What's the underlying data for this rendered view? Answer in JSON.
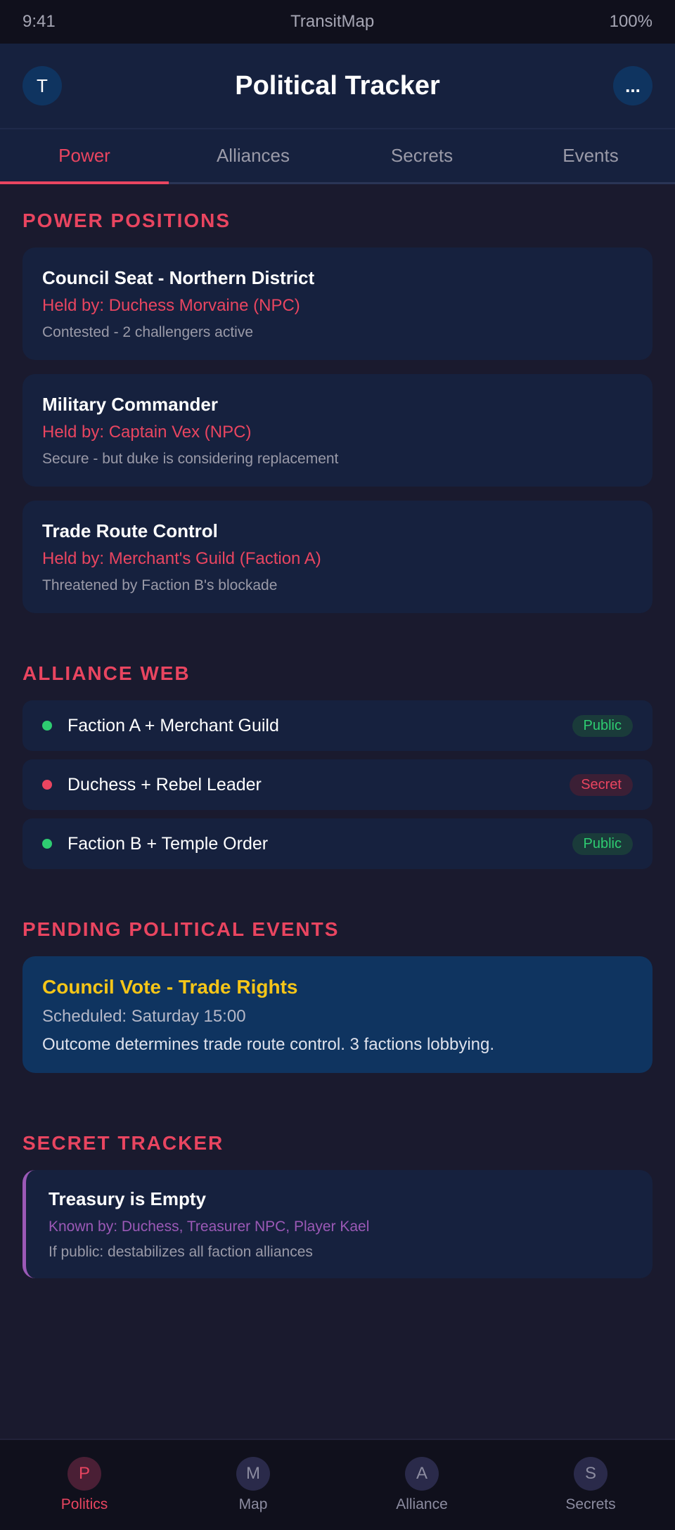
{
  "status_bar": {
    "time": "9:41",
    "carrier": "TransitMap",
    "battery": "100%"
  },
  "header": {
    "avatar_letter": "T",
    "title": "Political Tracker",
    "more_label": "..."
  },
  "tabs": [
    {
      "label": "Power"
    },
    {
      "label": "Alliances"
    },
    {
      "label": "Secrets"
    },
    {
      "label": "Events"
    }
  ],
  "power": {
    "section_title": "POWER POSITIONS",
    "items": [
      {
        "name": "Council Seat - Northern District",
        "holder": "Held by: Duchess Morvaine (NPC)",
        "status": "Contested - 2 challengers active"
      },
      {
        "name": "Military Commander",
        "holder": "Held by: Captain Vex (NPC)",
        "status": "Secure - but duke is considering replacement"
      },
      {
        "name": "Trade Route Control",
        "holder": "Held by: Merchant's Guild (Faction A)",
        "status": "Threatened by Faction B's blockade"
      }
    ]
  },
  "alliances": {
    "section_title": "ALLIANCE WEB",
    "items": [
      {
        "name": "Faction A + Merchant Guild",
        "badge": "Public",
        "status_color": "#2ecc71"
      },
      {
        "name": "Duchess + Rebel Leader",
        "badge": "Secret",
        "status_color": "#e94560"
      },
      {
        "name": "Faction B + Temple Order",
        "badge": "Public",
        "status_color": "#2ecc71"
      }
    ]
  },
  "events": {
    "section_title": "PENDING POLITICAL EVENTS",
    "items": [
      {
        "title": "Council Vote - Trade Rights",
        "scheduled": "Scheduled: Saturday 15:00",
        "description": "Outcome determines trade route control. 3 factions lobbying."
      }
    ]
  },
  "secrets": {
    "section_title": "SECRET TRACKER",
    "items": [
      {
        "title": "Treasury is Empty",
        "known_by": "Known by: Duchess, Treasurer NPC, Player Kael",
        "impact": "If public: destabilizes all faction alliances"
      }
    ]
  },
  "bottom_nav": [
    {
      "letter": "P",
      "label": "Politics"
    },
    {
      "letter": "M",
      "label": "Map"
    },
    {
      "letter": "A",
      "label": "Alliance"
    },
    {
      "letter": "S",
      "label": "Secrets"
    }
  ],
  "colors": {
    "accent": "#e94560",
    "background": "#1a1a2e",
    "card": "#16213e",
    "event_card": "#0f3460",
    "secret_border": "#9b59b6",
    "event_title": "#f5c518"
  }
}
